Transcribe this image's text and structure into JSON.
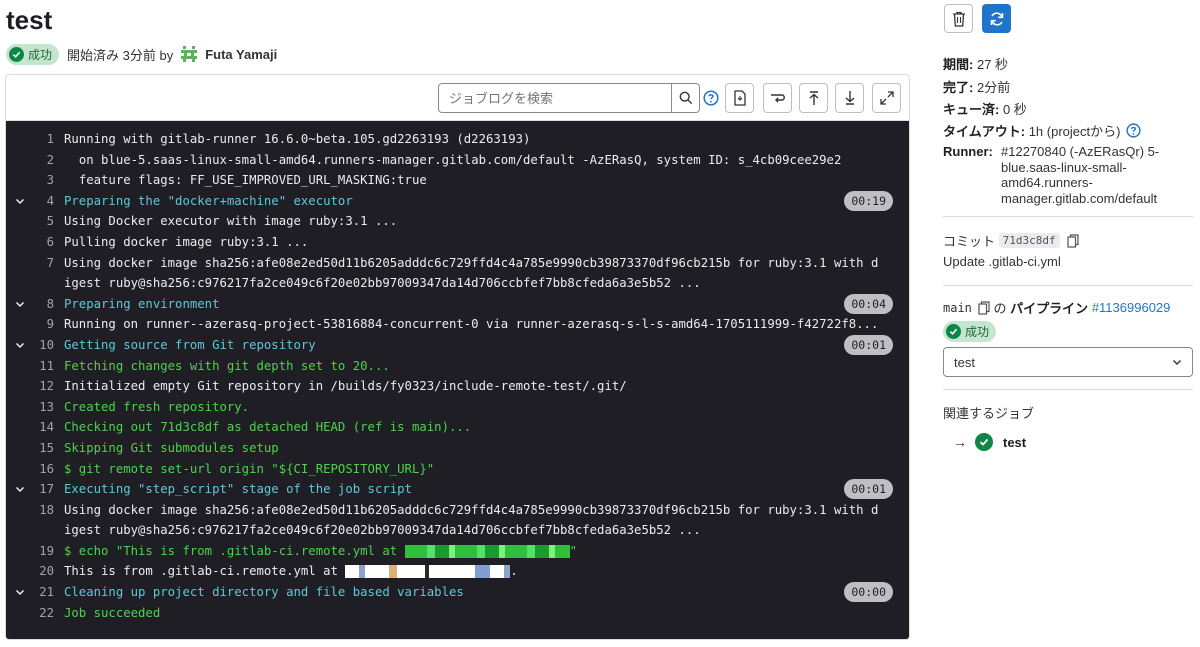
{
  "job": {
    "title": "test",
    "status": "成功",
    "started": "開始済み 3分前 by",
    "user": "Futa Yamaji"
  },
  "toolbar": {
    "search_placeholder": "ジョブログを検索"
  },
  "log": [
    {
      "n": "1",
      "text": "Running with gitlab-runner 16.6.0~beta.105.gd2263193 (d2263193)",
      "color": "default"
    },
    {
      "n": "2",
      "text": "  on blue-5.saas-linux-small-amd64.runners-manager.gitlab.com/default -AzERasQ, system ID: s_4cb09cee29e2",
      "color": "default"
    },
    {
      "n": "3",
      "text": "  feature flags: FF_USE_IMPROVED_URL_MASKING:true",
      "color": "default"
    },
    {
      "n": "4",
      "text": "Preparing the \"docker+machine\" executor",
      "color": "cyan",
      "section": true,
      "duration": "00:19"
    },
    {
      "n": "5",
      "text": "Using Docker executor with image ruby:3.1 ...",
      "color": "default"
    },
    {
      "n": "6",
      "text": "Pulling docker image ruby:3.1 ...",
      "color": "default"
    },
    {
      "n": "7",
      "text": "Using docker image sha256:afe08e2ed50d11b6205adddc6c729ffd4c4a785e9990cb39873370df96cb215b for ruby:3.1 with digest ruby@sha256:c976217fa2ce049c6f20e02bb97009347da14d706ccbfef7bb8cfeda6a3e5b52 ...",
      "color": "default",
      "wrapped": true,
      "part1": "Using docker image sha256:afe08e2ed50d11b6205adddc6c729ffd4c4a785e9990cb39873370df96cb215b for ruby:3.1 with d",
      "part2": "igest ruby@sha256:c976217fa2ce049c6f20e02bb97009347da14d706ccbfef7bb8cfeda6a3e5b52 ..."
    },
    {
      "n": "8",
      "text": "Preparing environment",
      "color": "cyan",
      "section": true,
      "duration": "00:04"
    },
    {
      "n": "9",
      "text": "Running on runner--azerasq-project-53816884-concurrent-0 via runner-azerasq-s-l-s-amd64-1705111999-f42722f8...",
      "color": "default"
    },
    {
      "n": "10",
      "text": "Getting source from Git repository",
      "color": "cyan",
      "section": true,
      "duration": "00:01"
    },
    {
      "n": "11",
      "text": "Fetching changes with git depth set to 20...",
      "color": "green"
    },
    {
      "n": "12",
      "text": "Initialized empty Git repository in /builds/fy0323/include-remote-test/.git/",
      "color": "default"
    },
    {
      "n": "13",
      "text": "Created fresh repository.",
      "color": "green"
    },
    {
      "n": "14",
      "text": "Checking out 71d3c8df as detached HEAD (ref is main)...",
      "color": "green"
    },
    {
      "n": "15",
      "text": "Skipping Git submodules setup",
      "color": "green"
    },
    {
      "n": "16",
      "text": "$ git remote set-url origin \"${CI_REPOSITORY_URL}\"",
      "color": "green"
    },
    {
      "n": "17",
      "text": "Executing \"step_script\" stage of the job script",
      "color": "cyan",
      "section": true,
      "duration": "00:01"
    },
    {
      "n": "18",
      "text": "Using docker image sha256:afe08e2ed50d11b6205adddc6c729ffd4c4a785e9990cb39873370df96cb215b for ruby:3.1 with digest ruby@sha256:c976217fa2ce049c6f20e02bb97009347da14d706ccbfef7bb8cfeda6a3e5b52 ...",
      "color": "default",
      "wrapped": true,
      "part1": "Using docker image sha256:afe08e2ed50d11b6205adddc6c729ffd4c4a785e9990cb39873370df96cb215b for ruby:3.1 with d",
      "part2": "igest ruby@sha256:c976217fa2ce049c6f20e02bb97009347da14d706ccbfef7bb8cfeda6a3e5b52 ..."
    },
    {
      "n": "19",
      "text": "$ echo \"This is from .gitlab-ci.remote.yml at ",
      "color": "green",
      "redacted": true,
      "suffix": "\""
    },
    {
      "n": "20",
      "text": "This is from .gitlab-ci.remote.yml at ",
      "color": "default",
      "redacted": true,
      "suffix": "."
    },
    {
      "n": "21",
      "text": "Cleaning up project directory and file based variables",
      "color": "cyan",
      "section": true,
      "duration": "00:00"
    },
    {
      "n": "22",
      "text": "Job succeeded",
      "color": "green"
    }
  ],
  "sidebar": {
    "duration_label": "期間:",
    "duration_value": "27 秒",
    "finished_label": "完了:",
    "finished_value": "2分前",
    "queued_label": "キュー済:",
    "queued_value": "0 秒",
    "timeout_label": "タイムアウト:",
    "timeout_value": "1h (projectから)",
    "runner_label": "Runner:",
    "runner_value": "#12270840 (-AzERasQr) 5-blue.saas-linux-small-amd64.runners-manager.gitlab.com/default",
    "commit_label": "コミット",
    "commit_sha": "71d3c8df",
    "commit_message": "Update .gitlab-ci.yml",
    "branch": "main",
    "pipeline_of": "の",
    "pipeline_label": "パイプライン",
    "pipeline_id": "#1136996029",
    "pipeline_status": "成功",
    "stage_select": "test",
    "related_jobs_label": "関連するジョブ",
    "related_job": "test"
  },
  "colors": {
    "success": "#108548",
    "accent": "#1f75cb",
    "log_bg": "#1f1e24",
    "log_cyan": "#5fc8d9",
    "log_green": "#4cd34c"
  }
}
